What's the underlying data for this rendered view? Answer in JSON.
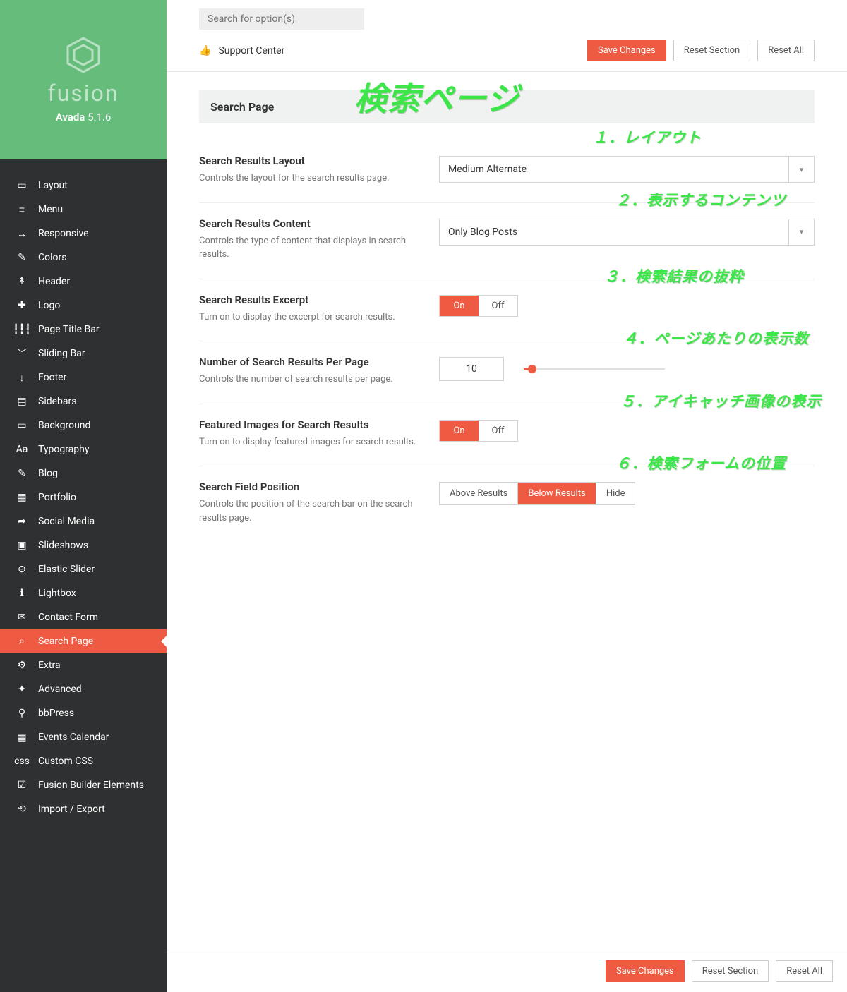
{
  "brand": {
    "name_line": "fusion",
    "product": "Avada",
    "version": "5.1.6"
  },
  "sidebar": {
    "items": [
      {
        "label": "Layout",
        "icon": "layout-icon",
        "glyph": "▭"
      },
      {
        "label": "Menu",
        "icon": "menu-icon",
        "glyph": "≡"
      },
      {
        "label": "Responsive",
        "icon": "responsive-icon",
        "glyph": "↔"
      },
      {
        "label": "Colors",
        "icon": "colors-icon",
        "glyph": "✎"
      },
      {
        "label": "Header",
        "icon": "header-icon",
        "glyph": "↟"
      },
      {
        "label": "Logo",
        "icon": "logo-icon",
        "glyph": "✚"
      },
      {
        "label": "Page Title Bar",
        "icon": "page-title-bar-icon",
        "glyph": "┇┇┇"
      },
      {
        "label": "Sliding Bar",
        "icon": "sliding-bar-icon",
        "glyph": "﹀"
      },
      {
        "label": "Footer",
        "icon": "footer-icon",
        "glyph": "↓"
      },
      {
        "label": "Sidebars",
        "icon": "sidebars-icon",
        "glyph": "▤"
      },
      {
        "label": "Background",
        "icon": "background-icon",
        "glyph": "▭"
      },
      {
        "label": "Typography",
        "icon": "typography-icon",
        "glyph": "Aa"
      },
      {
        "label": "Blog",
        "icon": "blog-icon",
        "glyph": "✎"
      },
      {
        "label": "Portfolio",
        "icon": "portfolio-icon",
        "glyph": "▦"
      },
      {
        "label": "Social Media",
        "icon": "social-media-icon",
        "glyph": "➦"
      },
      {
        "label": "Slideshows",
        "icon": "slideshows-icon",
        "glyph": "▣"
      },
      {
        "label": "Elastic Slider",
        "icon": "elastic-slider-icon",
        "glyph": "⊝"
      },
      {
        "label": "Lightbox",
        "icon": "lightbox-icon",
        "glyph": "ℹ"
      },
      {
        "label": "Contact Form",
        "icon": "contact-form-icon",
        "glyph": "✉"
      },
      {
        "label": "Search Page",
        "icon": "search-page-icon",
        "glyph": "⌕",
        "active": true
      },
      {
        "label": "Extra",
        "icon": "extra-icon",
        "glyph": "⚙"
      },
      {
        "label": "Advanced",
        "icon": "advanced-icon",
        "glyph": "✦"
      },
      {
        "label": "bbPress",
        "icon": "bbpress-icon",
        "glyph": "⚲"
      },
      {
        "label": "Events Calendar",
        "icon": "events-calendar-icon",
        "glyph": "▦"
      },
      {
        "label": "Custom CSS",
        "icon": "custom-css-icon",
        "glyph": "css"
      },
      {
        "label": "Fusion Builder Elements",
        "icon": "fusion-builder-icon",
        "glyph": "☑"
      },
      {
        "label": "Import / Export",
        "icon": "import-export-icon",
        "glyph": "⟲"
      }
    ]
  },
  "topbar": {
    "search_placeholder": "Search for option(s)",
    "support_label": "Support Center",
    "save_label": "Save Changes",
    "reset_section_label": "Reset Section",
    "reset_all_label": "Reset All"
  },
  "section": {
    "title": "Search Page"
  },
  "annotations": {
    "main": "検索ページ",
    "a1": "１．レイアウト",
    "a2": "２．表示するコンテンツ",
    "a3": "３．検索結果の抜粋",
    "a4": "４．ページあたりの表示数",
    "a5": "５．アイキャッチ画像の表示",
    "a6": "６．検索フォームの位置"
  },
  "options": {
    "layout": {
      "title": "Search Results Layout",
      "desc": "Controls the layout for the search results page.",
      "value": "Medium Alternate"
    },
    "content": {
      "title": "Search Results Content",
      "desc": "Controls the type of content that displays in search results.",
      "value": "Only Blog Posts"
    },
    "excerpt": {
      "title": "Search Results Excerpt",
      "desc": "Turn on to display the excerpt for search results.",
      "on": "On",
      "off": "Off",
      "value": "On"
    },
    "perpage": {
      "title": "Number of Search Results Per Page",
      "desc": "Controls the number of search results per page.",
      "value": "10"
    },
    "featured": {
      "title": "Featured Images for Search Results",
      "desc": "Turn on to display featured images for search results.",
      "on": "On",
      "off": "Off",
      "value": "On"
    },
    "position": {
      "title": "Search Field Position",
      "desc": "Controls the position of the search bar on the search results page.",
      "opts": [
        "Above Results",
        "Below Results",
        "Hide"
      ],
      "value": "Below Results"
    }
  }
}
